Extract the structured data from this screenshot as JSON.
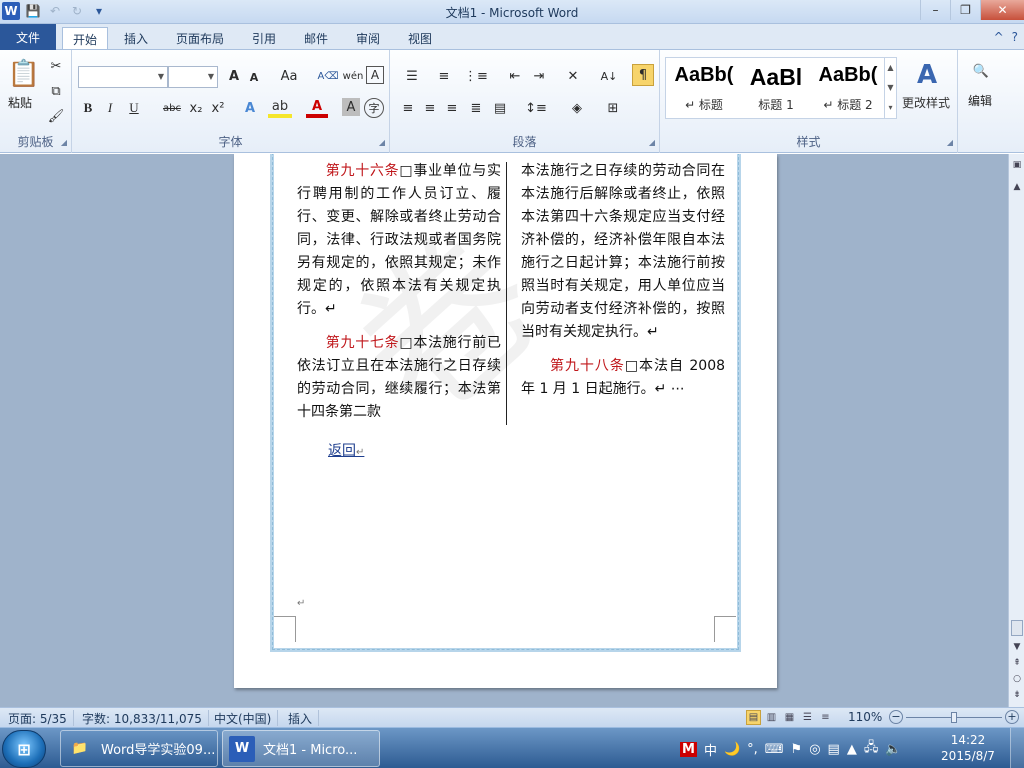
{
  "window": {
    "title": "文档1 - Microsoft Word",
    "minimize": "–",
    "restore": "❐",
    "close": "✕"
  },
  "qat": {
    "word_logo": "W",
    "save": "💾",
    "undo": "↶",
    "redo": "↻",
    "customize": "▾"
  },
  "tabs": {
    "file": "文件",
    "items": [
      "开始",
      "插入",
      "页面布局",
      "引用",
      "邮件",
      "审阅",
      "视图"
    ],
    "help": "?",
    "collapse": "^"
  },
  "ribbon": {
    "clipboard": {
      "label": "剪贴板",
      "paste": "粘贴"
    },
    "font": {
      "label": "字体",
      "font_name": "",
      "font_size": "",
      "grow": "A",
      "shrink": "A",
      "change_case": "Aa",
      "bold": "B",
      "italic": "I",
      "underline": "U",
      "strikethrough": "abc",
      "subscript": "x₂",
      "superscript": "x²",
      "font_color": "A",
      "char_shading": "A",
      "enclose": "字",
      "wen": "wén",
      "clear": "A"
    },
    "paragraph": {
      "label": "段落"
    },
    "styles": {
      "label": "样式",
      "items": [
        {
          "preview": "AaBb(",
          "name": "↵ 标题"
        },
        {
          "preview": "AaBl",
          "name": "标题 1"
        },
        {
          "preview": "AaBb(",
          "name": "↵ 标题 2"
        }
      ],
      "change_styles": "更改样式"
    },
    "editing": {
      "label": "编辑"
    }
  },
  "document": {
    "watermark": "卷",
    "col1": [
      {
        "article": "第九十六条",
        "text": "□事业单位与实行聘用制的工作人员订立、履行、变更、解除或者终止劳动合同，法律、行政法规或者国务院另有规定的，依照其规定；未作规定的，依照本法有关规定执行。↵"
      },
      {
        "article": "第九十七条",
        "text": "□本法施行前已依法订立且在本法施行之日存续的劳动合同，继续履行；本法第十四条第二款"
      }
    ],
    "col2": [
      {
        "article": "",
        "text": "本法施行之日存续的劳动合同在本法施行后解除或者终止，依照本法第四十六条规定应当支付经济补偿的，经济补偿年限自本法施行之日起计算；本法施行前按照当时有关规定，用人单位应当向劳动者支付经济补偿的，按照当时有关规定执行。↵"
      },
      {
        "article": "第九十八条",
        "text": "□本法自 2008 年 1 月 1 日起施行。↵ ⋯"
      }
    ],
    "back_link": "返回",
    "back_mark": "↵",
    "empty_mark": "↵"
  },
  "statusbar": {
    "page": "页面: 5/35",
    "words": "字数: 10,833/11,075",
    "language": "中文(中国)",
    "mode": "插入",
    "zoom": "110%",
    "zoom_level_fraction": 0.5
  },
  "taskbar": {
    "start": "⊞",
    "apps": [
      {
        "label": "Word导学实验09...",
        "icon": "📁"
      },
      {
        "label": "文档1 - Micro...",
        "icon": "W"
      }
    ],
    "tray": [
      "M",
      "中",
      "🌙",
      "°,",
      "⌨",
      "🔈"
    ],
    "time": "14:22",
    "date": "2015/8/7"
  }
}
